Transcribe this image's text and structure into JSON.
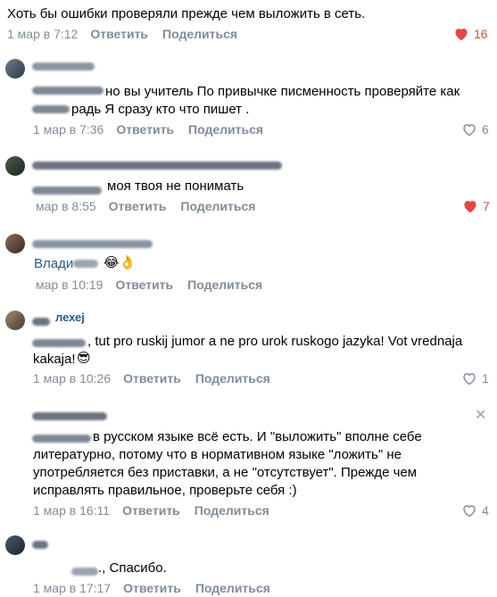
{
  "post": {
    "text": "Хоть бы ошибки проверяли прежде чем выложить в сеть.",
    "time": "1 мар в 7:12",
    "reply": "Ответить",
    "share": "Поделиться",
    "likes": "16"
  },
  "comments": [
    {
      "text": "но вы учитель По привычке писменность проверяйте как",
      "text2": "радь Я сразу кто что пишет .",
      "time": "1 мар в 7:36",
      "reply": "Ответить",
      "share": "Поделиться",
      "likes": "6"
    },
    {
      "text": "моя твоя не понимать",
      "time": "мар в 8:55",
      "reply": "Ответить",
      "share": "Поделиться",
      "likes": "7"
    },
    {
      "text": "Влади",
      "emoji": "😂👌",
      "time": "мар в 10:19",
      "reply": "Ответить",
      "share": "Поделиться"
    },
    {
      "author": "лехеj",
      "text": ", tut pro ruskij jumor a ne pro urok ruskogo jazyka! Vot vrednaja",
      "text2": "kakaja!",
      "emoji": "😎",
      "time": "1 мар в 10:26",
      "reply": "Ответить",
      "share": "Поделиться",
      "likes": "1"
    },
    {
      "text": "в русском языке всё есть. И \"выложить\" вполне себе",
      "text2": "литературно, потому что в нормативном языке \"ложить\" не",
      "text3": "употребляется без приставки, а не \"отсутствует\". Прежде чем",
      "text4": "исправлять правильное, проверьте себя :)",
      "time": "1 мар в 16:11",
      "reply": "Ответить",
      "share": "Поделиться",
      "likes": "4",
      "close": "✕"
    },
    {
      "text": "., Спасибо.",
      "time": "1 мар в 17:17",
      "reply": "Ответить",
      "share": "Поделиться"
    }
  ],
  "colors": {
    "meta": "#818c99",
    "like_active": "#e64646"
  },
  "icons": {
    "heart": "heart-icon",
    "heart_outline": "heart-outline-icon",
    "close": "close-icon"
  }
}
